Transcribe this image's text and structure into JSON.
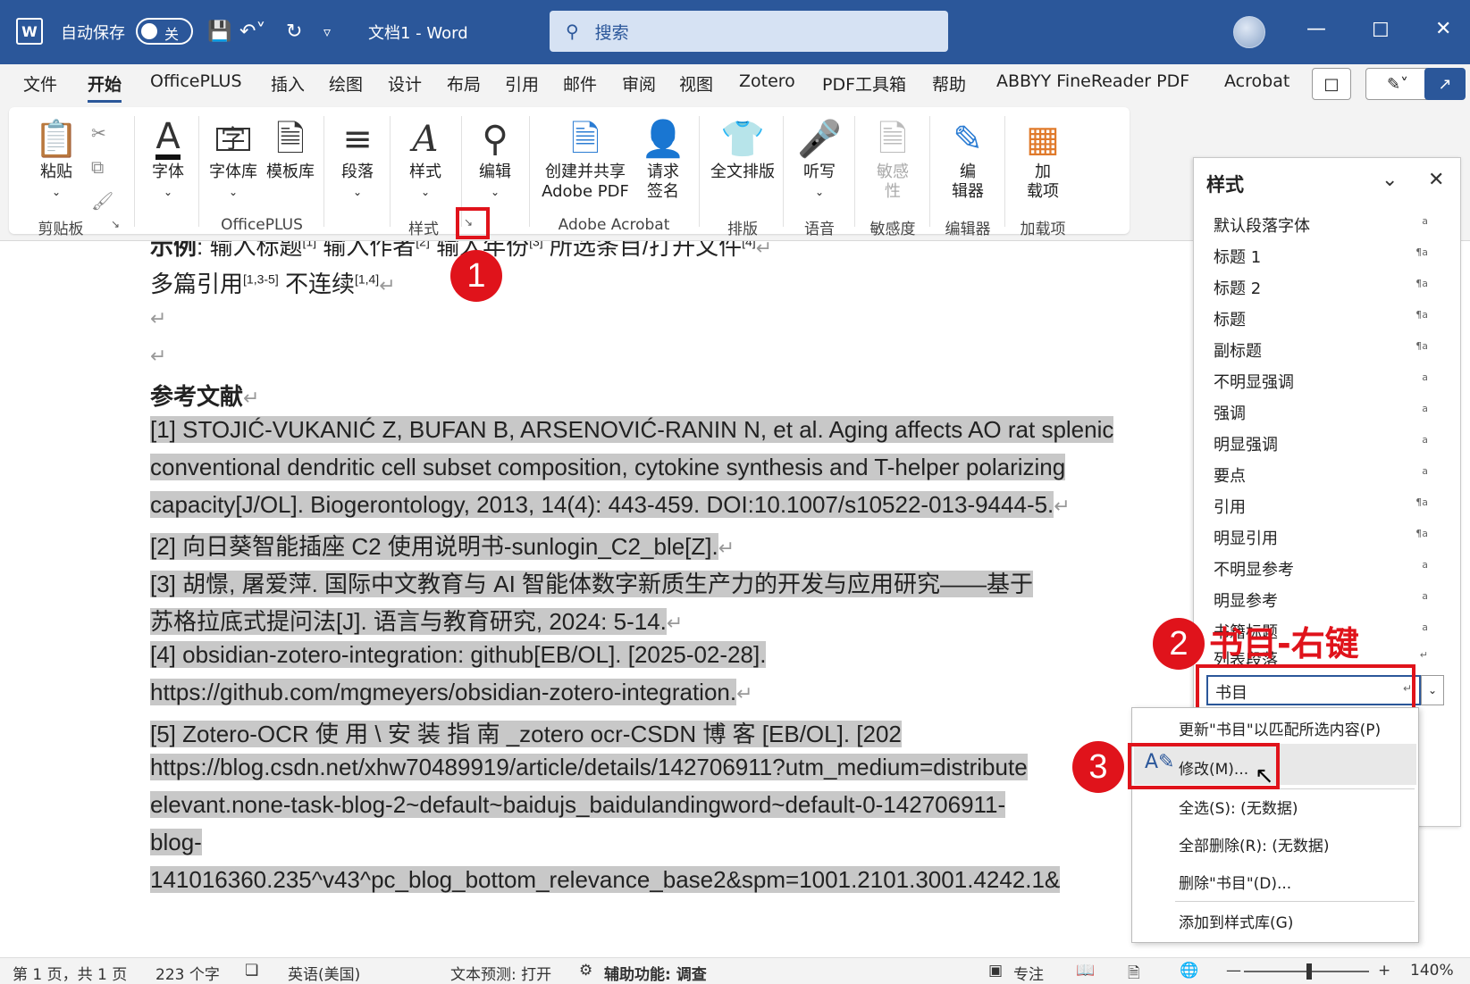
{
  "titlebar": {
    "autosave_label": "自动保存",
    "autosave_state": "关",
    "doc_title": "文档1  -  Word",
    "search_placeholder": "搜索"
  },
  "menu": {
    "tabs": [
      "文件",
      "开始",
      "OfficePLUS",
      "插入",
      "绘图",
      "设计",
      "布局",
      "引用",
      "邮件",
      "审阅",
      "视图",
      "Zotero",
      "PDF工具箱",
      "帮助",
      "ABBYY FineReader PDF",
      "Acrobat"
    ],
    "active": "开始"
  },
  "ribbon": {
    "paste": "粘贴",
    "font": "字体",
    "font_lib": "字体库",
    "template_lib": "模板库",
    "paragraph": "段落",
    "styles": "样式",
    "edit": "编辑",
    "create_share_1": "创建并共享",
    "create_share_2": "Adobe PDF",
    "request_sign_1": "请求",
    "request_sign_2": "签名",
    "full_layout": "全文排版",
    "dictate": "听写",
    "sensitivity_1": "敏感",
    "sensitivity_2": "性",
    "editor_1": "编",
    "editor_2": "辑器",
    "addins_1": "加",
    "addins_2": "载项",
    "groups": {
      "clipboard": "剪贴板",
      "officeplus": "OfficePLUS",
      "styles": "样式",
      "adobe": "Adobe Acrobat",
      "layout": "排版",
      "voice": "语音",
      "sensitivity": "敏感度",
      "editor": "编辑器",
      "addins": "加载项"
    }
  },
  "document": {
    "line1_a": "示例",
    "line1_b": ": 输入标题",
    "line1_sup1": "[1]",
    "line1_c": " 输入作者",
    "line1_sup2": "[2]",
    "line1_d": " 输入年份",
    "line1_sup3": "[3]",
    "line1_e": "  所选条目/打开文件",
    "line1_sup4": "[4]",
    "line2_a": "多篇引用",
    "line2_sup1": "[1,3-5]",
    "line2_b": "  不连续",
    "line2_sup2": "[1,4]",
    "ref_heading": "参考文献",
    "refs": [
      "[1]   STOJIĆ-VUKANIĆ Z, BUFAN B, ARSENOVIĆ-RANIN N, et al. Aging affects AO rat splenic",
      "conventional dendritic cell subset composition, cytokine synthesis and T-helper polarizing",
      "capacity[J/OL]. Biogerontology, 2013, 14(4): 443-459. DOI:10.1007/s10522-013-9444-5.",
      "[2]   向日葵智能插座 C2 使用说明书-sunlogin_C2_ble[Z].",
      "[3]   胡憬, 屠爱萍. 国际中文教育与 AI 智能体数字新质生产力的开发与应用研究——基于",
      "苏格拉底式提问法[J]. 语言与教育研究, 2024: 5-14.",
      "[4]   obsidian-zotero-integration:                          github[EB/OL].                  [2025-02-28].",
      "https://github.com/mgmeyers/obsidian-zotero-integration.",
      "[5]   Zotero-OCR   使 用 \\ 安 装 指 南  _zotero   ocr-CSDN   博 客 [EB/OL].   [202",
      "https://blog.csdn.net/xhw70489919/article/details/142706911?utm_medium=distribute",
      "elevant.none-task-blog-2~default~baidujs_baidulandingword~default-0-142706911-",
      "blog-",
      "141016360.235^v43^pc_blog_bottom_relevance_base2&spm=1001.2101.3001.4242.1&"
    ]
  },
  "styles_pane": {
    "title": "样式",
    "items": [
      {
        "name": "默认段落字体",
        "sym": "a"
      },
      {
        "name": "标题 1",
        "sym": "¶a"
      },
      {
        "name": "标题 2",
        "sym": "¶a"
      },
      {
        "name": "标题",
        "sym": "¶a"
      },
      {
        "name": "副标题",
        "sym": "¶a"
      },
      {
        "name": "不明显强调",
        "sym": "a"
      },
      {
        "name": "强调",
        "sym": "a"
      },
      {
        "name": "明显强调",
        "sym": "a"
      },
      {
        "name": "要点",
        "sym": "a"
      },
      {
        "name": "引用",
        "sym": "¶a"
      },
      {
        "name": "明显引用",
        "sym": "¶a"
      },
      {
        "name": "不明显参考",
        "sym": "a"
      },
      {
        "name": "明显参考",
        "sym": "a"
      },
      {
        "name": "书籍标题",
        "sym": "a"
      },
      {
        "name": "列表段落",
        "sym": "↵"
      }
    ],
    "selected": "书目",
    "selected_sym": "↵"
  },
  "context_menu": {
    "items": [
      "更新\"书目\"以匹配所选内容(P)",
      "修改(M)...",
      "全选(S): (无数据)",
      "全部删除(R): (无数据)",
      "删除\"书目\"(D)...",
      "添加到样式库(G)"
    ]
  },
  "annotations": {
    "step1": "1",
    "step2": "2",
    "step3": "3",
    "label2": "书目-右键"
  },
  "status": {
    "page": "第 1 页，共 1 页",
    "words": "223 个字",
    "lang": "英语(美国)",
    "predict": "文本预测: 打开",
    "access": "辅助功能: 调查",
    "focus": "专注",
    "zoom": "140%"
  },
  "colors": {
    "title_bar": "#2b579a",
    "annotation_red": "#e0131b",
    "highlight": "#c8c8c8"
  }
}
